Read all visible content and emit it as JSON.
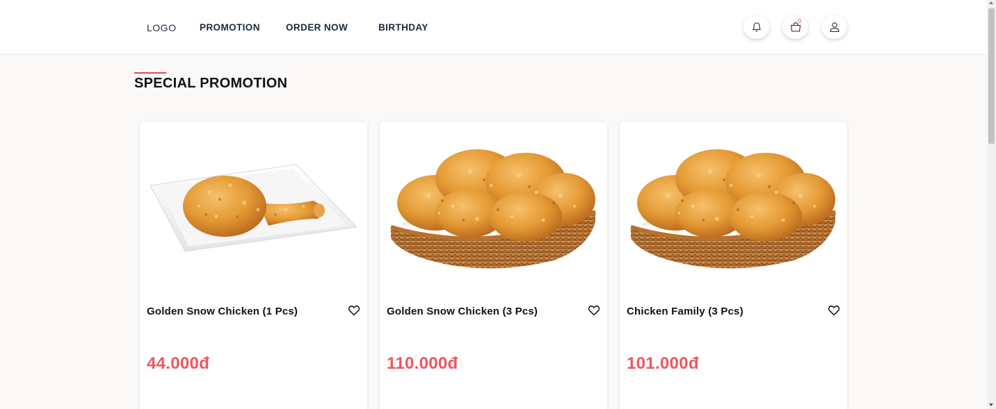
{
  "header": {
    "logo": "LOGO",
    "nav": [
      {
        "label": "PROMOTION"
      },
      {
        "label": "ORDER NOW"
      },
      {
        "label": "BIRTHDAY"
      }
    ],
    "actions": {
      "bell_icon": "bell-icon",
      "cart_icon": "cart-icon",
      "cart_count": "0",
      "user_icon": "user-icon"
    }
  },
  "section": {
    "title": "SPECIAL PROMOTION",
    "accent_color": "#e5484d"
  },
  "products": [
    {
      "name": "Golden Snow Chicken (1 Pcs)",
      "price": "44.000đ",
      "image": "fried-chicken-drumstick-plate"
    },
    {
      "name": "Golden Snow Chicken (3 Pcs)",
      "price": "110.000đ",
      "image": "fried-chicken-basket"
    },
    {
      "name": "Chicken Family (3 Pcs)",
      "price": "101.000đ",
      "image": "fried-chicken-basket"
    }
  ],
  "colors": {
    "price": "#f0555e",
    "nav_text": "#1b2a3c"
  }
}
